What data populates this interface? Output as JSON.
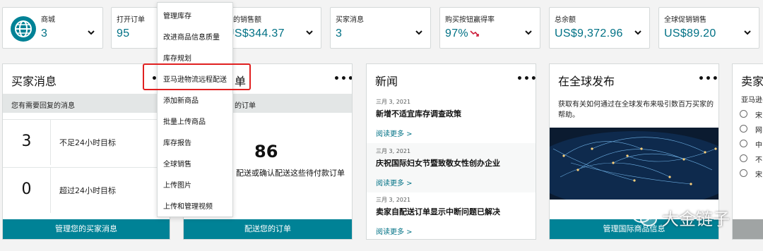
{
  "metrics": [
    {
      "label": "商城",
      "value": "3"
    },
    {
      "label": "打开订单",
      "value": "95"
    },
    {
      "label": "天的销售额",
      "value": "US$344.37"
    },
    {
      "label": "买家消息",
      "value": "3"
    },
    {
      "label": "购买按钮赢得率",
      "value": "97%"
    },
    {
      "label": "总余额",
      "value": "US$9,372.96"
    },
    {
      "label": "全球促销销售",
      "value": "US$89.20"
    }
  ],
  "dropdown": {
    "items": [
      "管理库存",
      "改进商品信息质量",
      "库存规划",
      "亚马逊物流远程配送",
      "添加新商品",
      "批量上传商品",
      "库存报告",
      "全球销售",
      "上传图片",
      "上传和管理视频"
    ],
    "highlighted": "亚马逊物流远程配送"
  },
  "buyer_messages": {
    "title": "买家消息",
    "more": "•••",
    "subtitle": "您有需要回复的消息",
    "rows": [
      {
        "count": "3",
        "text": "不足24小时目标"
      },
      {
        "count": "0",
        "text": "超过24小时目标"
      }
    ],
    "button": "管理您的买家消息"
  },
  "orders": {
    "title_fragment": "单",
    "more": "•••",
    "subtitle_fragment": "的订单",
    "count": "86",
    "desc": "配送或确认配送这些待付款订单",
    "button": "配送您的订单"
  },
  "news": {
    "title": "新闻",
    "more": "•••",
    "items": [
      {
        "date": "三月 3, 2021",
        "headline": "新增不适宜库存调查政策",
        "more": "阅读更多 >"
      },
      {
        "date": "三月 3, 2021",
        "headline": "庆祝国际妇女节暨致敬女性创办企业",
        "more": "阅读更多 >"
      },
      {
        "date": "三月 3, 2021",
        "headline": "卖家自配送订单显示中断问题已解决",
        "more": "阅读更多 >"
      }
    ]
  },
  "global": {
    "title": "在全球发布",
    "more": "•••",
    "desc": "获取有关如何通过在全球发布来吸引数百万买家的帮助。",
    "button": "管理国际商品信息"
  },
  "partial_card": {
    "title": "卖家",
    "subtitle": "亚马逊",
    "options": [
      "宋",
      "网",
      "中",
      "不",
      "宋"
    ]
  },
  "watermark": {
    "text": "大金链子"
  },
  "colors": {
    "teal": "#008296",
    "link": "#007185",
    "highlight": "#e02020"
  }
}
